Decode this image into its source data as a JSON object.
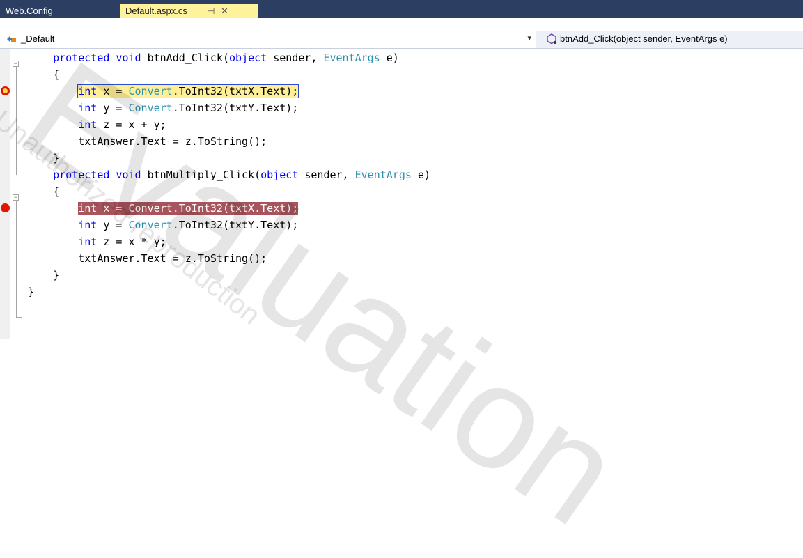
{
  "tabs": [
    {
      "label": "Web.Config",
      "active": false
    },
    {
      "label": "Default.aspx.cs",
      "active": true,
      "pin": "⊣",
      "close": "✕"
    }
  ],
  "nav": {
    "class_label": "_Default",
    "method_label": "btnAdd_Click(object sender, EventArgs e)"
  },
  "code_lines": [
    {
      "indent": "    ",
      "tokens": [
        [
          "kw",
          "protected"
        ],
        [
          "t",
          " "
        ],
        [
          "kw",
          "void"
        ],
        [
          "t",
          " btnAdd_Click("
        ],
        [
          "kw",
          "object"
        ],
        [
          "t",
          " sender, "
        ],
        [
          "ty",
          "EventArgs"
        ],
        [
          "t",
          " e)"
        ]
      ]
    },
    {
      "indent": "    ",
      "tokens": [
        [
          "t",
          "{"
        ]
      ]
    },
    {
      "indent": "        ",
      "tokens": [
        [
          "kw",
          "int"
        ],
        [
          "t",
          " x = "
        ],
        [
          "ty",
          "Convert"
        ],
        [
          "t",
          ".ToInt32(txtX.Text);"
        ]
      ],
      "highlight": "current"
    },
    {
      "indent": "        ",
      "tokens": [
        [
          "kw",
          "int"
        ],
        [
          "t",
          " y = "
        ],
        [
          "ty",
          "Convert"
        ],
        [
          "t",
          ".ToInt32(txtY.Text);"
        ]
      ]
    },
    {
      "indent": "        ",
      "tokens": [
        [
          "kw",
          "int"
        ],
        [
          "t",
          " z = x + y;"
        ]
      ]
    },
    {
      "indent": "        ",
      "tokens": [
        [
          "t",
          "txtAnswer.Text = z.ToString();"
        ]
      ]
    },
    {
      "indent": "    ",
      "tokens": [
        [
          "t",
          "}"
        ]
      ]
    },
    {
      "indent": "    ",
      "tokens": [
        [
          "kw",
          "protected"
        ],
        [
          "t",
          " "
        ],
        [
          "kw",
          "void"
        ],
        [
          "t",
          " btnMultiply_Click("
        ],
        [
          "kw",
          "object"
        ],
        [
          "t",
          " sender, "
        ],
        [
          "ty",
          "EventArgs"
        ],
        [
          "t",
          " e)"
        ]
      ]
    },
    {
      "indent": "    ",
      "tokens": [
        [
          "t",
          "{"
        ]
      ]
    },
    {
      "indent": "        ",
      "tokens": [
        [
          "kw",
          "int"
        ],
        [
          "t",
          " x = "
        ],
        [
          "ty",
          "Convert"
        ],
        [
          "t",
          ".ToInt32(txtX.Text);"
        ]
      ],
      "highlight": "breakpoint"
    },
    {
      "indent": "        ",
      "tokens": [
        [
          "kw",
          "int"
        ],
        [
          "t",
          " y = "
        ],
        [
          "ty",
          "Convert"
        ],
        [
          "t",
          ".ToInt32(txtY.Text);"
        ]
      ]
    },
    {
      "indent": "        ",
      "tokens": [
        [
          "kw",
          "int"
        ],
        [
          "t",
          " z = x * y;"
        ]
      ]
    },
    {
      "indent": "        ",
      "tokens": [
        [
          "t",
          "txtAnswer.Text = z.ToString();"
        ]
      ]
    },
    {
      "indent": "    ",
      "tokens": [
        [
          "t",
          "}"
        ]
      ]
    },
    {
      "indent": "",
      "tokens": [
        [
          "t",
          "}"
        ]
      ]
    }
  ],
  "breakpoints": [
    {
      "line": 2,
      "kind": "current-breakpoint-icon"
    },
    {
      "line": 9,
      "kind": "breakpoint-icon"
    }
  ],
  "watermark": {
    "big": "Evaluation",
    "small": "Unauthorized reproduction"
  },
  "colors": {
    "keyword": "#0000ff",
    "type": "#2b91af",
    "current_line": "#ffef96",
    "breakpoint_line": "#a8545c",
    "breakpoint_dot": "#e51400",
    "tab_active": "#fff29d",
    "tabbar": "#2c3f63"
  }
}
